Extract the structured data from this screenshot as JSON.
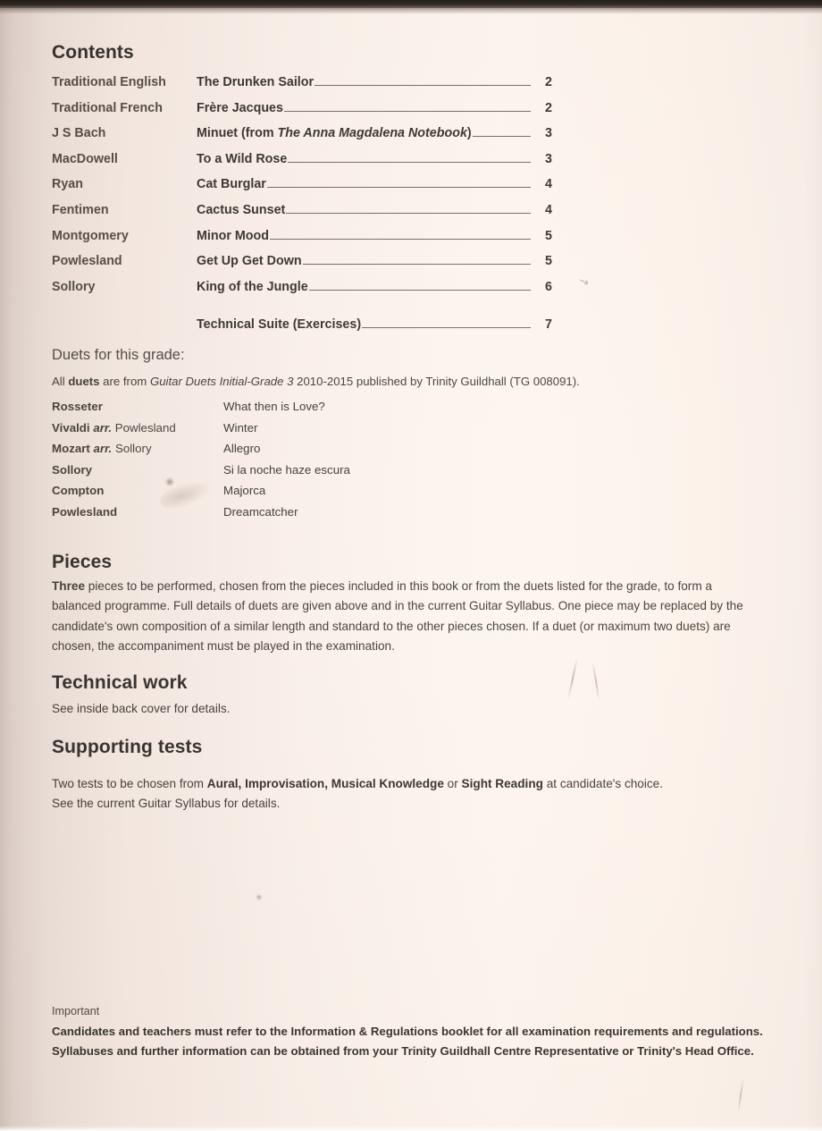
{
  "document": {
    "contents_heading": "Contents",
    "toc": {
      "rows": [
        {
          "composer": "Traditional English",
          "title": "The Drunken Sailor",
          "page": "2"
        },
        {
          "composer": "Traditional French",
          "title": "Frère Jacques",
          "page": "2"
        },
        {
          "composer": "J S Bach",
          "title_pre": "Minuet (from ",
          "title_em": "The Anna Magdalena Notebook",
          "title_post": ")",
          "page": "3"
        },
        {
          "composer": "MacDowell",
          "title": "To a Wild Rose",
          "page": "3"
        },
        {
          "composer": "Ryan",
          "title": "Cat Burglar",
          "page": "4"
        },
        {
          "composer": "Fentimen",
          "title": "Cactus Sunset",
          "page": "4"
        },
        {
          "composer": "Montgomery",
          "title": "Minor Mood",
          "page": "5"
        },
        {
          "composer": "Powlesland",
          "title": "Get Up Get Down",
          "page": "5"
        },
        {
          "composer": "Sollory",
          "title": "King of the Jungle",
          "page": "6"
        },
        {
          "composer": "",
          "title": "Technical Suite (Exercises)",
          "page": "7"
        }
      ]
    },
    "duets": {
      "heading": "Duets for this grade:",
      "note_pre": "All ",
      "note_bold": "duets",
      "note_mid": " are from ",
      "note_em": "Guitar Duets Initial-Grade 3",
      "note_post": " 2010-2015 published by Trinity Guildhall (TG 008091).",
      "rows": [
        {
          "composer_lead": "Rosseter",
          "composer_em": "",
          "composer_tail": "",
          "title": "What then is Love?"
        },
        {
          "composer_lead": "Vivaldi ",
          "composer_em": "arr.",
          "composer_tail": " Powlesland",
          "title": "Winter"
        },
        {
          "composer_lead": "Mozart ",
          "composer_em": "arr.",
          "composer_tail": " Sollory",
          "title": "Allegro"
        },
        {
          "composer_lead": "Sollory",
          "composer_em": "",
          "composer_tail": "",
          "title": "Si la noche haze escura"
        },
        {
          "composer_lead": "Compton",
          "composer_em": "",
          "composer_tail": "",
          "title": "Majorca"
        },
        {
          "composer_lead": "Powlesland",
          "composer_em": "",
          "composer_tail": "",
          "title": "Dreamcatcher"
        }
      ]
    },
    "pieces": {
      "heading": "Pieces",
      "lead_bold": "Three",
      "body": " pieces to be performed, chosen from the pieces included in this book or from the duets listed for the grade, to form a balanced programme. Full details of duets are given above and in the current Guitar Syllabus. One piece may be replaced by the candidate's own composition of a similar length and standard to the other pieces chosen. If a duet (or maximum two duets) are chosen, the accompaniment must be played in the examination."
    },
    "technical": {
      "heading": "Technical work",
      "body": "See inside back cover for details."
    },
    "supporting": {
      "heading": "Supporting tests",
      "line1_pre": "Two tests to be chosen from ",
      "line1_bold1": "Aural, Improvisation, Musical Knowledge",
      "line1_mid": " or ",
      "line1_bold2": "Sight Reading",
      "line1_post": " at candidate's choice.",
      "line2": "See the current Guitar Syllabus for details."
    },
    "important": {
      "label": "Important",
      "body": "Candidates and teachers must refer to the Information & Regulations booklet for all examination requirements and regulations. Syllabuses and further information can be obtained from your Trinity Guildhall Centre Representative or Trinity's Head Office."
    },
    "marks": {
      "pencil_arrow": "↘"
    }
  },
  "colors": {
    "paper_light": "#fdf3eb",
    "paper_shadow": "#cfc0b9",
    "ink": "#2e2a28",
    "ink_soft": "#4a443e",
    "leader_line": "#6e6560",
    "scan_band": "#17120f"
  }
}
